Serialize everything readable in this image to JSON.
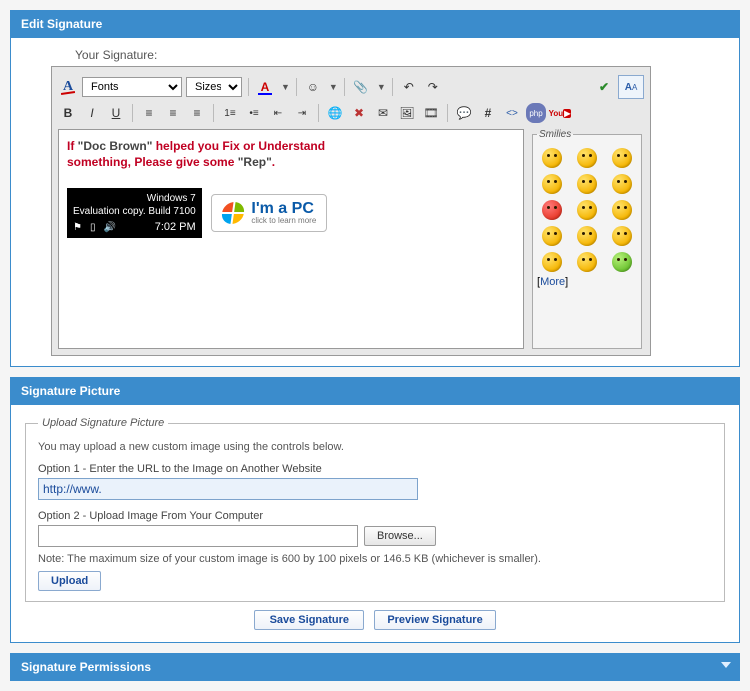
{
  "sections": {
    "editSignature": "Edit Signature",
    "signaturePicture": "Signature Picture",
    "signaturePermissions": "Signature Permissions"
  },
  "yourSignatureLabel": "Your Signature:",
  "toolbar": {
    "fontsLabel": "Fonts",
    "sizesLabel": "Sizes",
    "icons": {
      "removeFormat": "remove-format-icon",
      "fontColor": "font-color-icon",
      "smiley": "smiley-icon",
      "attach": "attach-icon",
      "undo": "undo-icon",
      "redo": "redo-icon",
      "spellcheck": "spellcheck-icon",
      "toggleMode": "toggle-mode-icon",
      "bold": "B",
      "italic": "I",
      "underline": "U",
      "alignLeft": "align-left-icon",
      "alignCenter": "align-center-icon",
      "alignRight": "align-right-icon",
      "olist": "ordered-list-icon",
      "ulist": "unordered-list-icon",
      "outdent": "outdent-icon",
      "indent": "indent-icon",
      "link": "link-icon",
      "unlink": "unlink-icon",
      "email": "email-icon",
      "image": "image-icon",
      "video": "video-icon",
      "quote": "quote-icon",
      "hash": "#",
      "html": "<>",
      "php": "php-icon",
      "youtube": "youtube-icon"
    }
  },
  "signatureContent": {
    "line1_a": "If ",
    "line1_b": "\"Doc Brown\"",
    "line1_c": " helped you Fix or Understand",
    "line2_a": "something, Please give some ",
    "line2_b": "\"Rep\"",
    "line2_c": ".",
    "winBadge": {
      "row1": "Windows 7",
      "row2": "Evaluation copy. Build 7100",
      "time": "7:02 PM"
    },
    "pcBadge": {
      "big": "I'm a PC",
      "small": "click to learn more"
    }
  },
  "smilies": {
    "legend": "Smilies",
    "moreLabel": "More",
    "items": [
      "smile",
      "biggrin",
      "wink",
      "frown",
      "confused",
      "angry-red",
      "mad-red",
      "cry",
      "cool",
      "grin",
      "eek",
      "tongue",
      "rolleyes",
      "huh",
      "sick-green"
    ]
  },
  "upload": {
    "legend": "Upload Signature Picture",
    "blurb": "You may upload a new custom image using the controls below.",
    "option1": "Option 1 - Enter the URL to the Image on Another Website",
    "urlValue": "http://www.",
    "option2": "Option 2 - Upload Image From Your Computer",
    "browseLabel": "Browse...",
    "note": "Note: The maximum size of your custom image is 600 by 100 pixels or 146.5 KB (whichever is smaller).",
    "uploadLabel": "Upload"
  },
  "actions": {
    "save": "Save Signature",
    "preview": "Preview Signature"
  }
}
